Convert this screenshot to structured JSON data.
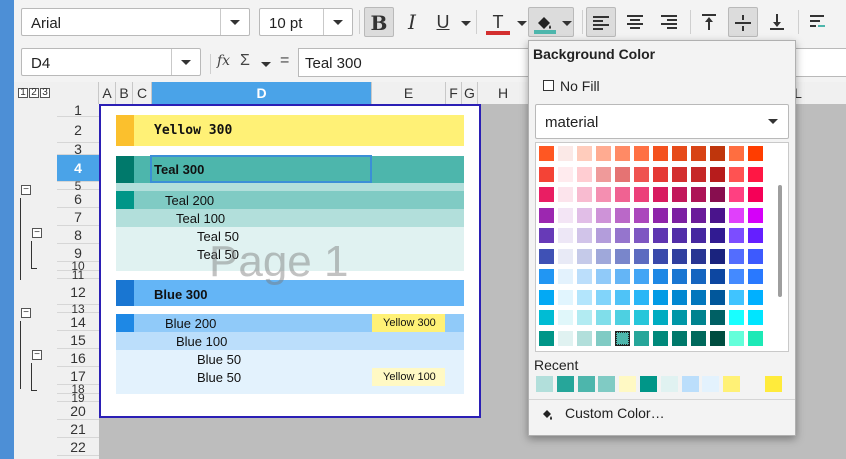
{
  "toolbar": {
    "font_name": "Arial",
    "font_size": "10 pt",
    "bold_label": "B",
    "italic_label": "I",
    "underline_label": "U",
    "font_color_label": "T",
    "font_color_accent": "#d32f2f"
  },
  "formula_bar": {
    "name_box": "D4",
    "fx_label": "fx",
    "sigma_label": "Σ",
    "equals_label": "=",
    "content": "Teal 300"
  },
  "columns": [
    "A",
    "B",
    "C",
    "D",
    "E",
    "F",
    "G",
    "H",
    "L"
  ],
  "outline_levels": [
    "1",
    "2",
    "3"
  ],
  "rows": [
    "1",
    "2",
    "3",
    "4",
    "5",
    "6",
    "7",
    "8",
    "9",
    "10",
    "11",
    "12",
    "13",
    "14",
    "15",
    "16",
    "17",
    "18",
    "19",
    "20",
    "21",
    "22"
  ],
  "cells": {
    "yellow300": "Yellow 300",
    "teal300": "Teal 300",
    "teal200": "Teal 200",
    "teal100": "Teal 100",
    "teal50a": "Teal 50",
    "teal50b": "Teal 50",
    "blue300": "Blue 300",
    "blue200": "Blue 200",
    "yellow300_tag": "Yellow 300",
    "blue100": "Blue 100",
    "blue50a": "Blue 50",
    "blue50b": "Blue 50",
    "yellow100_tag": "Yellow 100"
  },
  "page_watermark": "Page 1",
  "popup": {
    "title": "Background Color",
    "no_fill": "No Fill",
    "palette": "material",
    "recent_label": "Recent",
    "custom_color": "Custom Color…",
    "grid": [
      [
        "#ff5722",
        "#fbe9e7",
        "#ffccbc",
        "#ffab91",
        "#ff8a65",
        "#ff7043",
        "#f4511e",
        "#e64a19",
        "#d84315",
        "#bf360c",
        "#ff6e40",
        "#ff3d00"
      ],
      [
        "#f44336",
        "#ffebee",
        "#ffcdd2",
        "#ef9a9a",
        "#e57373",
        "#ef5350",
        "#e53935",
        "#d32f2f",
        "#c62828",
        "#b71c1c",
        "#ff5252",
        "#ff1744"
      ],
      [
        "#e91e63",
        "#fce4ec",
        "#f8bbd0",
        "#f48fb1",
        "#f06292",
        "#ec407a",
        "#d81b60",
        "#c2185b",
        "#ad1457",
        "#880e4f",
        "#ff4081",
        "#f50057"
      ],
      [
        "#9c27b0",
        "#f3e5f5",
        "#e1bee7",
        "#ce93d8",
        "#ba68c8",
        "#ab47bc",
        "#8e24aa",
        "#7b1fa2",
        "#6a1b9a",
        "#4a148c",
        "#e040fb",
        "#d500f9"
      ],
      [
        "#673ab7",
        "#ede7f6",
        "#d1c4e9",
        "#b39ddb",
        "#9575cd",
        "#7e57c2",
        "#5e35b1",
        "#512da8",
        "#4527a0",
        "#311b92",
        "#7c4dff",
        "#651fff"
      ],
      [
        "#3f51b5",
        "#e8eaf6",
        "#c5cae9",
        "#9fa8da",
        "#7986cb",
        "#5c6bc0",
        "#3949ab",
        "#303f9f",
        "#283593",
        "#1a237e",
        "#536dfe",
        "#3d5afe"
      ],
      [
        "#2196f3",
        "#e3f2fd",
        "#bbdefb",
        "#90caf9",
        "#64b5f6",
        "#42a5f5",
        "#1e88e5",
        "#1976d2",
        "#1565c0",
        "#0d47a1",
        "#448aff",
        "#2979ff"
      ],
      [
        "#03a9f4",
        "#e1f5fe",
        "#b3e5fc",
        "#81d4fa",
        "#4fc3f7",
        "#29b6f6",
        "#039be5",
        "#0288d1",
        "#0277bd",
        "#01579b",
        "#40c4ff",
        "#00b0ff"
      ],
      [
        "#00bcd4",
        "#e0f7fa",
        "#b2ebf2",
        "#80deea",
        "#4dd0e1",
        "#26c6da",
        "#00acc1",
        "#0097a7",
        "#00838f",
        "#006064",
        "#18ffff",
        "#00e5ff"
      ],
      [
        "#009688",
        "#e0f2f1",
        "#b2dfdb",
        "#80cbc4",
        "#4db6ac",
        "#26a69a",
        "#00897b",
        "#00796b",
        "#00695c",
        "#004d40",
        "#64ffda",
        "#1de9b6"
      ]
    ],
    "selected": [
      9,
      4
    ],
    "recent": [
      "#b2dfdb",
      "#26a69a",
      "#4db6ac",
      "#80cbc4",
      "#fff9c4",
      "#009688",
      "#e0f2f1",
      "#bbdefb",
      "#e3f2fd",
      "#fff176",
      "#f3f3f3",
      "#ffeb3b"
    ]
  }
}
